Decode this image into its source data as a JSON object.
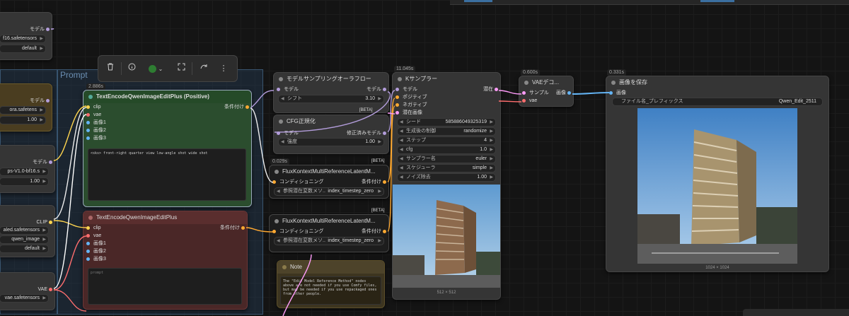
{
  "toolbar": {
    "items": [
      "trash-icon",
      "info-icon",
      "color-picker",
      "fit-icon",
      "bypass-icon",
      "more-icon"
    ]
  },
  "group": {
    "title": "Prompt"
  },
  "left_nodes": {
    "n1": {
      "output": "モデル",
      "widget1": "f16.safetensors",
      "widget2": "default"
    },
    "n2": {
      "output": "モデル",
      "widget1": "ora.safetens",
      "widget2": "1.00"
    },
    "n3": {
      "output": "モデル",
      "widget1": "ps-V1.0-bf16.s",
      "widget2": "1.00"
    },
    "n4": {
      "output": "CLIP",
      "widget1": "aled.safetensors",
      "widget2": "qwen_image",
      "widget3": "default"
    },
    "n5": {
      "output": "VAE",
      "widget1": "vae.safetensors"
    }
  },
  "pos_node": {
    "time": "2.886s",
    "title": "TextEncodeQwenImageEditPlus (Positive)",
    "inputs": [
      "clip",
      "vae",
      "画像1",
      "画像2",
      "画像3"
    ],
    "output": "条件付け",
    "prompt": "<sks> front-right quarter view low-angle shot wide shot"
  },
  "neg_node": {
    "title": "TextEncodeQwenImageEditPlus",
    "inputs": [
      "clip",
      "vae",
      "画像1",
      "画像2",
      "画像3"
    ],
    "output": "条件付け",
    "placeholder": "prompt"
  },
  "sampling_node": {
    "title": "モデルサンプリングオーラフロー",
    "input": "モデル",
    "output": "モデル",
    "widget_label": "シフト",
    "widget_value": "3.10",
    "badge": "[BETA]"
  },
  "cfg_node": {
    "title": "CFG正規化",
    "input": "モデル",
    "output": "修正済みモデル",
    "widget_label": "強度",
    "widget_value": "1.00"
  },
  "flux1": {
    "time": "0.029s",
    "badge": "[BETA]",
    "title": "FluxKontextMultiReferenceLatentM...",
    "input": "コンディショニング",
    "output": "条件付け",
    "widget_label": "参照潜在変数メソ..",
    "widget_value": "index_timestep_zero"
  },
  "flux2": {
    "badge": "[BETA]",
    "title": "FluxKontextMultiReferenceLatentM...",
    "input": "コンディショニング",
    "output": "条件付け",
    "widget_label": "参照潜在変数メソ..",
    "widget_value": "index_timestep_zero"
  },
  "note": {
    "title": "Note",
    "text": "The \"Edit Model Reference Method\" nodes above are not needed if you use Comfy files, but may be needed if you use repackaged ones from other people."
  },
  "ksampler": {
    "time": "11.045s",
    "title": "Kサンプラー",
    "inputs": [
      "モデル",
      "ポジティブ",
      "ネガティブ",
      "潜在画像"
    ],
    "output": "潜在",
    "widgets": [
      {
        "k": "シード",
        "v": "585886049325319"
      },
      {
        "k": "生成後の制御",
        "v": "randomize"
      },
      {
        "k": "ステップ",
        "v": "4"
      },
      {
        "k": "cfg",
        "v": "1.0"
      },
      {
        "k": "サンプラー名",
        "v": "euler"
      },
      {
        "k": "スケジューラ",
        "v": "simple"
      },
      {
        "k": "ノイズ除去",
        "v": "1.00"
      }
    ],
    "preview_size": "512 × 512"
  },
  "vae_decode": {
    "time": "0.600s",
    "title": "VAEデコ...",
    "inputs": [
      "サンプル",
      "vae"
    ],
    "output": "画像"
  },
  "save_node": {
    "time": "0.331s",
    "title": "画像を保存",
    "input": "画像",
    "widget_label": "ファイル名_プレフィックス",
    "widget_value": "Qwen_Edit_2511",
    "preview_size": "1024 × 1024"
  },
  "colors": {
    "model": "#b39ddb",
    "clip": "#ffd54f",
    "vae": "#ff6e6e",
    "cond": "#ffa931",
    "latent": "#ff9cf9",
    "image": "#64b5f6"
  }
}
